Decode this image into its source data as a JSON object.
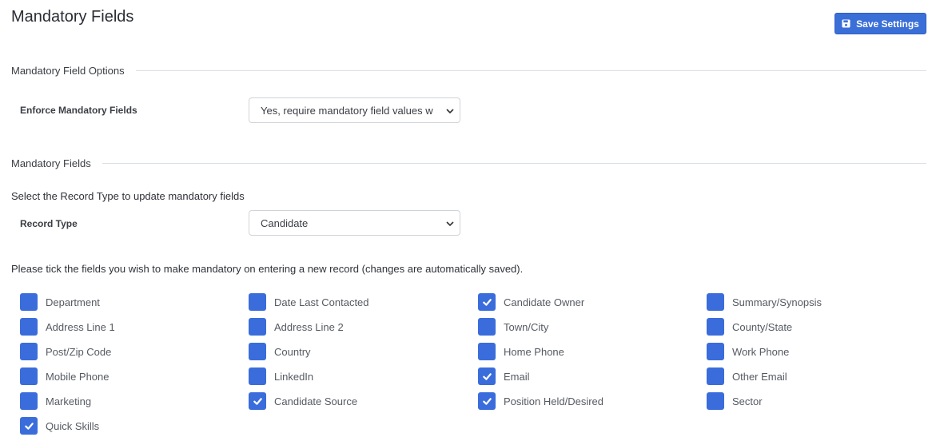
{
  "header": {
    "title": "Mandatory Fields",
    "save_label": "Save Settings"
  },
  "options_section": {
    "heading": "Mandatory Field Options",
    "enforce_label": "Enforce Mandatory Fields",
    "enforce_value": "Yes, require mandatory field values w"
  },
  "fields_section": {
    "heading": "Mandatory Fields",
    "record_type_prompt": "Select the Record Type to update mandatory fields",
    "record_type_label": "Record Type",
    "record_type_value": "Candidate",
    "instructions": "Please tick the fields you wish to make mandatory on entering a new record (changes are automatically saved)."
  },
  "checkboxes": [
    {
      "label": "Department",
      "checked": false
    },
    {
      "label": "Date Last Contacted",
      "checked": false
    },
    {
      "label": "Candidate Owner",
      "checked": true
    },
    {
      "label": "Summary/Synopsis",
      "checked": false
    },
    {
      "label": "Address Line 1",
      "checked": false
    },
    {
      "label": "Address Line 2",
      "checked": false
    },
    {
      "label": "Town/City",
      "checked": false
    },
    {
      "label": "County/State",
      "checked": false
    },
    {
      "label": "Post/Zip Code",
      "checked": false
    },
    {
      "label": "Country",
      "checked": false
    },
    {
      "label": "Home Phone",
      "checked": false
    },
    {
      "label": "Work Phone",
      "checked": false
    },
    {
      "label": "Mobile Phone",
      "checked": false
    },
    {
      "label": "LinkedIn",
      "checked": false
    },
    {
      "label": "Email",
      "checked": true
    },
    {
      "label": "Other Email",
      "checked": false
    },
    {
      "label": "Marketing",
      "checked": false
    },
    {
      "label": "Candidate Source",
      "checked": true
    },
    {
      "label": "Position Held/Desired",
      "checked": true
    },
    {
      "label": "Sector",
      "checked": false
    },
    {
      "label": "Quick Skills",
      "checked": true
    }
  ],
  "colors": {
    "accent": "#3a6ddb",
    "button": "#3b6fd8"
  }
}
